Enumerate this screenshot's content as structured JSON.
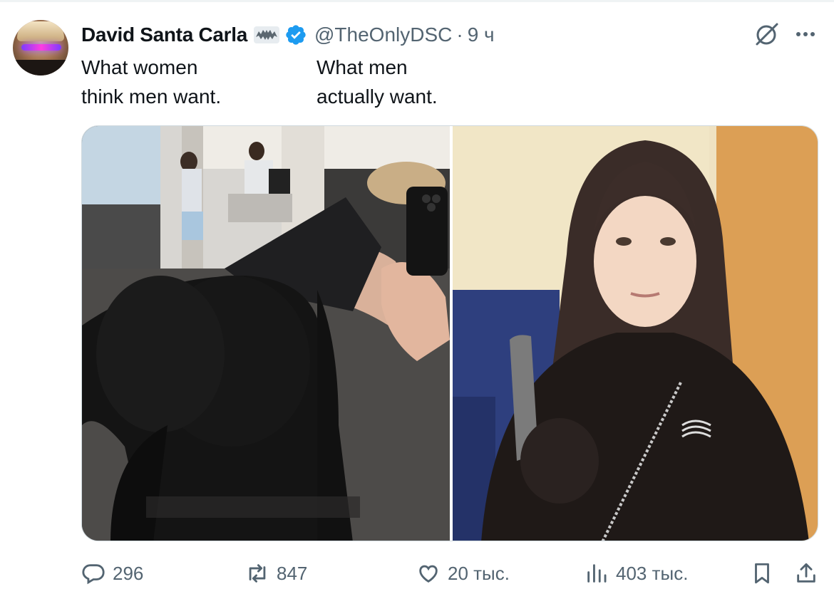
{
  "tweet": {
    "author": {
      "display_name": "David Santa Carla",
      "handle": "@TheOnlyDSC",
      "verified": true,
      "avatar_icon": "avatar",
      "badge_icon": "bat-icon"
    },
    "separator": "·",
    "time": "9 ч",
    "text_left": [
      "What women",
      "think men want."
    ],
    "text_right": [
      "What men",
      "actually want."
    ],
    "media": [
      {
        "label": "gym-selfie-photo"
      },
      {
        "label": "portrait-photo"
      }
    ],
    "actions": {
      "replies": "296",
      "reposts": "847",
      "likes": "20 тыс.",
      "views": "403 тыс."
    },
    "colors": {
      "text": "#0f1419",
      "secondary": "#536471",
      "verified": "#1d9bf0",
      "border": "#cfd9de"
    },
    "icons": [
      "grok-icon",
      "more-icon",
      "reply-icon",
      "repost-icon",
      "like-icon",
      "views-icon",
      "bookmark-icon",
      "share-icon"
    ]
  }
}
